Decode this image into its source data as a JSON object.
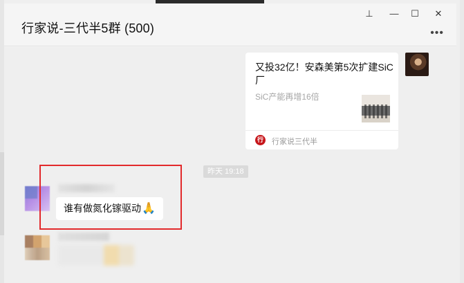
{
  "window": {
    "title": "行家说-三代半5群 (500)",
    "controls": {
      "pin": "⊥",
      "minimize": "—",
      "maximize": "☐",
      "close": "✕"
    },
    "more": "•••"
  },
  "messages": {
    "link_card": {
      "title": "又投32亿！安森美第5次扩建SiC厂",
      "subtitle": "SiC产能再增16倍",
      "source_icon": "行",
      "source": "行家说三代半"
    },
    "timestamp": "昨天 19:18",
    "text_message": {
      "text": "谁有做氮化镓驱动",
      "emoji": "🙏"
    }
  },
  "colors": {
    "highlight": "#e2292b",
    "source_brand": "#c6161b"
  }
}
